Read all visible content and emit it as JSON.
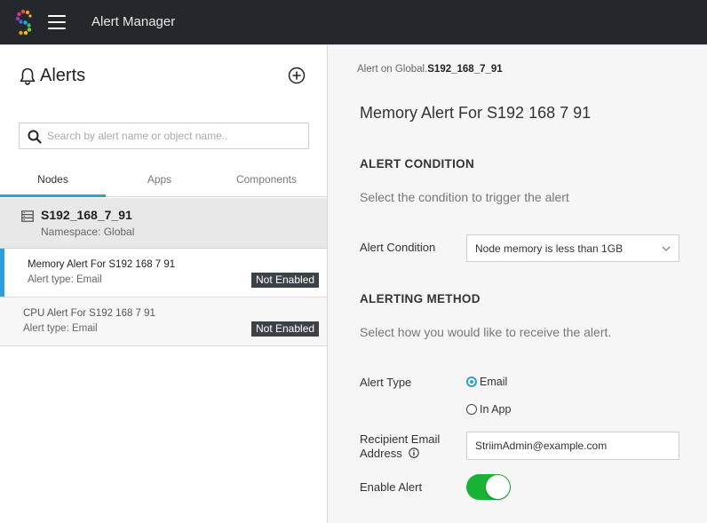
{
  "header": {
    "app_title": "Alert Manager",
    "logo_icon": "striim-logo-icon",
    "menu_icon": "hamburger-menu-icon"
  },
  "sidebar": {
    "title": "Alerts",
    "title_icon": "bell-icon",
    "add_icon": "plus-circle-icon",
    "search": {
      "placeholder": "Search by alert name or object name..",
      "value": ""
    },
    "tabs": [
      {
        "label": "Nodes",
        "active": true
      },
      {
        "label": "Apps",
        "active": false
      },
      {
        "label": "Components",
        "active": false
      }
    ],
    "node": {
      "name": "S192_168_7_91",
      "namespace": "Namespace: Global"
    },
    "alerts": [
      {
        "name": "Memory Alert For S192 168 7 91",
        "type": "Alert type: Email",
        "status": "Not Enabled",
        "selected": true
      },
      {
        "name": "CPU Alert For S192 168 7 91",
        "type": "Alert type: Email",
        "status": "Not Enabled",
        "selected": false
      }
    ]
  },
  "detail": {
    "breadcrumb_prefix": "Alert on Global.",
    "breadcrumb_object": "S192_168_7_91",
    "title": "Memory Alert For S192 168 7 91",
    "condition_section": {
      "heading": "ALERT CONDITION",
      "description": "Select the condition to trigger the alert",
      "label": "Alert Condition",
      "selected": "Node memory is less than 1GB"
    },
    "method_section": {
      "heading": "ALERTING METHOD",
      "description": "Select how you would like to receive the alert.",
      "alert_type_label": "Alert Type",
      "options": [
        {
          "label": "Email",
          "checked": true
        },
        {
          "label": "In App",
          "checked": false
        }
      ],
      "recipient_label_line1": "Recipient Email",
      "recipient_label_line2": "Address",
      "recipient_value": "StriimAdmin@example.com",
      "enable_label": "Enable Alert",
      "enabled": true
    }
  },
  "colors": {
    "accent": "#2f9ddb",
    "toggle_on": "#18b336",
    "topbar": "#24282c",
    "badge": "#3b4147"
  }
}
